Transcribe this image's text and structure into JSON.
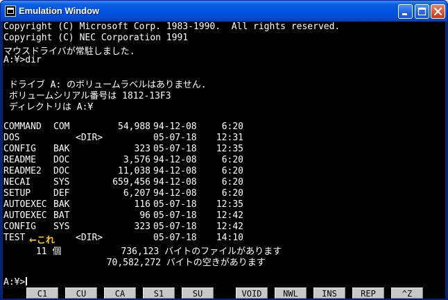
{
  "window": {
    "title": "Emulation Window"
  },
  "console": {
    "header_lines": [
      "Copyright (C) Microsoft Corp. 1983-1990.  All rights reserved.",
      "Copyright (C) NEC Corporation 1991",
      "マウスドライバが常駐しました.",
      "A:¥>dir"
    ],
    "volume_lines": [
      " ドライブ A: のボリュームラベルはありません.",
      " ボリュームシリアル番号は 1812-13F3",
      " ディレクトリは A:¥"
    ],
    "entries": [
      {
        "name": "COMMAND",
        "ext": "COM",
        "dir": "",
        "size": "54,988",
        "date": "94-12-08",
        "time": "6:20"
      },
      {
        "name": "DOS",
        "ext": "",
        "dir": "<DIR>",
        "size": "",
        "date": "05-07-18",
        "time": "12:31"
      },
      {
        "name": "CONFIG",
        "ext": "BAK",
        "dir": "",
        "size": "323",
        "date": "05-07-18",
        "time": "12:35"
      },
      {
        "name": "README",
        "ext": "DOC",
        "dir": "",
        "size": "3,576",
        "date": "94-12-08",
        "time": "6:20"
      },
      {
        "name": "README2",
        "ext": "DOC",
        "dir": "",
        "size": "11,038",
        "date": "94-12-08",
        "time": "6:20"
      },
      {
        "name": "NECAI",
        "ext": "SYS",
        "dir": "",
        "size": "659,456",
        "date": "94-12-08",
        "time": "6:20"
      },
      {
        "name": "SETUP",
        "ext": "DEF",
        "dir": "",
        "size": "6,207",
        "date": "94-12-08",
        "time": "6:20"
      },
      {
        "name": "AUTOEXEC",
        "ext": "BAK",
        "dir": "",
        "size": "116",
        "date": "05-07-18",
        "time": "12:35"
      },
      {
        "name": "AUTOEXEC",
        "ext": "BAT",
        "dir": "",
        "size": "96",
        "date": "05-07-18",
        "time": "12:42"
      },
      {
        "name": "CONFIG",
        "ext": "SYS",
        "dir": "",
        "size": "323",
        "date": "05-07-18",
        "time": "12:42"
      },
      {
        "name": "TEST",
        "ext": "",
        "dir": "<DIR>",
        "size": "",
        "date": "05-07-18",
        "time": "14:10"
      }
    ],
    "callout": {
      "arrow": "←",
      "text": "これ",
      "color": "#ffcc00"
    },
    "summary_lines": [
      "      11 個           736,123 バイトのファイルがあります",
      "                   70,582,272 バイトの空きがあります"
    ],
    "prompt": "A:¥>"
  },
  "function_keys": [
    "C1",
    "CU",
    "CA",
    "S1",
    "SU",
    "VOID",
    "NWL",
    "INS",
    "REP",
    "^Z"
  ],
  "colors": {
    "titlebar": "#0053e1",
    "console_bg": "#000000",
    "console_text": "#ffffff",
    "close_button": "#d9512f"
  }
}
